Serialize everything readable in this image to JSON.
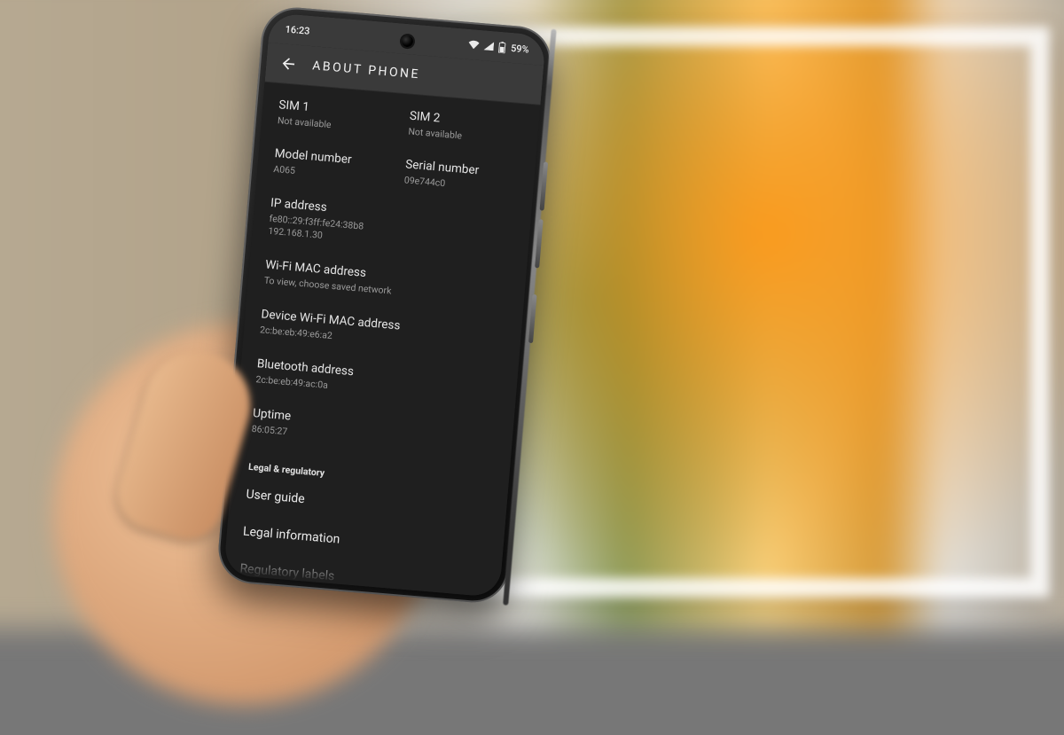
{
  "statusbar": {
    "time": "16:23",
    "battery_pct": "59%"
  },
  "appbar": {
    "title": "ABOUT PHONE"
  },
  "sim1": {
    "label": "SIM 1",
    "value": "Not available"
  },
  "sim2": {
    "label": "SIM 2",
    "value": "Not available"
  },
  "model": {
    "label": "Model number",
    "value": "A065"
  },
  "serial": {
    "label": "Serial number",
    "value": "09e744c0"
  },
  "ip": {
    "label": "IP address",
    "value": "fe80::29:f3ff:fe24:38b8\n192.168.1.30"
  },
  "wifi_mac": {
    "label": "Wi-Fi MAC address",
    "value": "To view, choose saved network"
  },
  "device_wifi_mac": {
    "label": "Device Wi-Fi MAC address",
    "value": "2c:be:eb:49:e6:a2"
  },
  "bt": {
    "label": "Bluetooth address",
    "value": "2c:be:eb:49:ac:0a"
  },
  "uptime": {
    "label": "Uptime",
    "value": "86:05:27"
  },
  "section_legal": "Legal & regulatory",
  "links": {
    "user_guide": "User guide",
    "legal_info": "Legal information",
    "regulatory": "Regulatory labels"
  }
}
